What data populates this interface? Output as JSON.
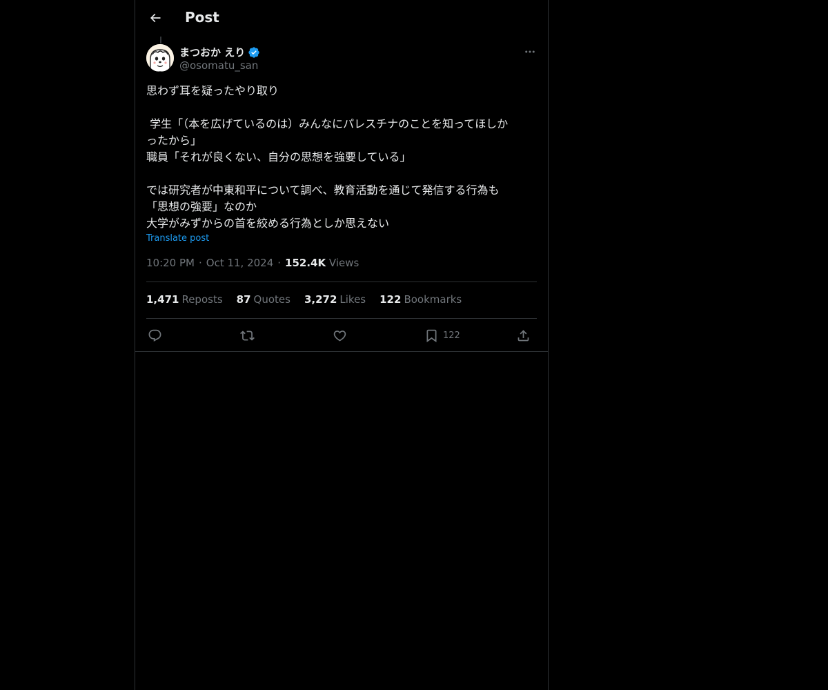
{
  "header": {
    "title": "Post"
  },
  "author": {
    "display_name": "まつおか えり",
    "handle": "@osomatu_san",
    "verified": true
  },
  "tweet": {
    "lines": [
      "思わず耳を疑ったやり取り",
      "",
      " 学生「（本を広げているのは）みんなにパレスチナのことを知ってほしか",
      "ったから」",
      "職員「それが良くない、自分の思想を強要している」",
      "",
      "では研究者が中東和平について調べ、教育活動を通じて発信する行為も",
      "「思想の強要」なのか",
      "大学がみずからの首を絞める行為としか思えない"
    ],
    "translate_label": "Translate post"
  },
  "meta": {
    "time": "10:20 PM",
    "date": "Oct 11, 2024",
    "views_count": "152.4K",
    "views_label": "Views",
    "separator": "·"
  },
  "stats": {
    "reposts_count": "1,471",
    "reposts_label": "Reposts",
    "quotes_count": "87",
    "quotes_label": "Quotes",
    "likes_count": "3,272",
    "likes_label": "Likes",
    "bookmarks_count": "122",
    "bookmarks_label": "Bookmarks"
  },
  "actions": {
    "bookmark_count": "122",
    "icons": [
      "reply-icon",
      "repost-icon",
      "like-icon",
      "bookmark-icon",
      "share-icon"
    ]
  },
  "colors": {
    "background": "#000000",
    "text_primary": "#e7e9ea",
    "text_secondary": "#71767b",
    "accent": "#1d9bf0",
    "border": "#2f3336"
  }
}
